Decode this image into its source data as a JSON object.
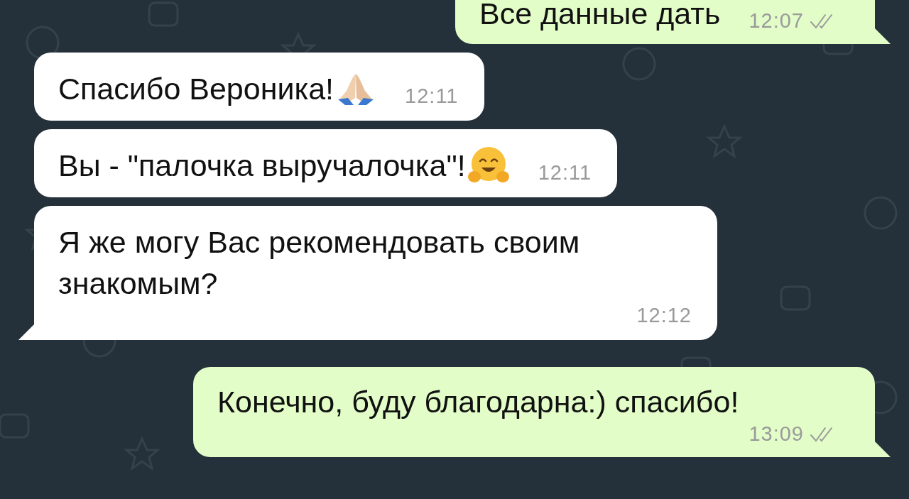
{
  "messages": [
    {
      "outgoing": true,
      "text": "Все данные дать",
      "time": "12:07",
      "read": false,
      "tail": true
    },
    {
      "outgoing": false,
      "kind": "prayer",
      "text": "Спасибо Вероника!",
      "time": "12:11",
      "tail": false
    },
    {
      "outgoing": false,
      "kind": "hug",
      "text": "Вы - \"палочка выручалочка\"!",
      "time": "12:11",
      "tail": false
    },
    {
      "outgoing": false,
      "kind": "plain",
      "text": "Я же могу Вас рекомендовать своим знакомым?",
      "time": "12:12",
      "tail": true
    },
    {
      "outgoing": true,
      "text": "Конечно, буду благодарна:) спасибо!",
      "time": "13:09",
      "read": false,
      "tail": true
    }
  ]
}
